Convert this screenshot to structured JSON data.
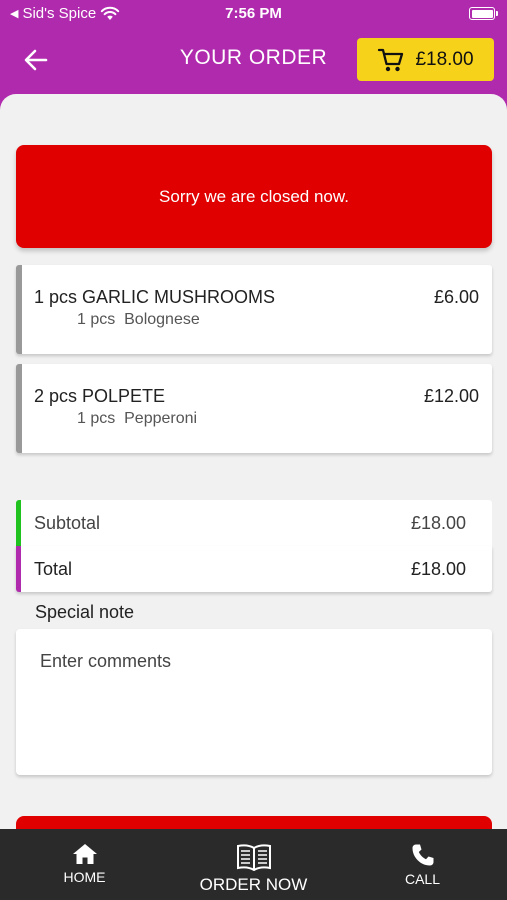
{
  "status_bar": {
    "back_app": "Sid's Spice",
    "time": "7:56 PM"
  },
  "header": {
    "title": "YOUR ORDER",
    "cart_total": "£18.00"
  },
  "banner": {
    "message": "Sorry we are closed now."
  },
  "items": [
    {
      "name": "1 pcs GARLIC MUSHROOMS",
      "price": "£6.00",
      "sub": "1 pcs  Bolognese"
    },
    {
      "name": "2 pcs POLPETE",
      "price": "£12.00",
      "sub": "1 pcs  Pepperoni"
    }
  ],
  "totals": {
    "subtotal_label": "Subtotal",
    "subtotal_value": "£18.00",
    "total_label": "Total",
    "total_value": "£18.00"
  },
  "note": {
    "label": "Special note",
    "placeholder": "Enter comments"
  },
  "bottom_nav": {
    "home": "HOME",
    "order_now": "ORDER NOW",
    "call": "CALL"
  },
  "colors": {
    "brand_purple": "#b02aad",
    "alert_red": "#e00000",
    "cart_yellow": "#f7d21b",
    "subtotal_green": "#1fc21f"
  }
}
